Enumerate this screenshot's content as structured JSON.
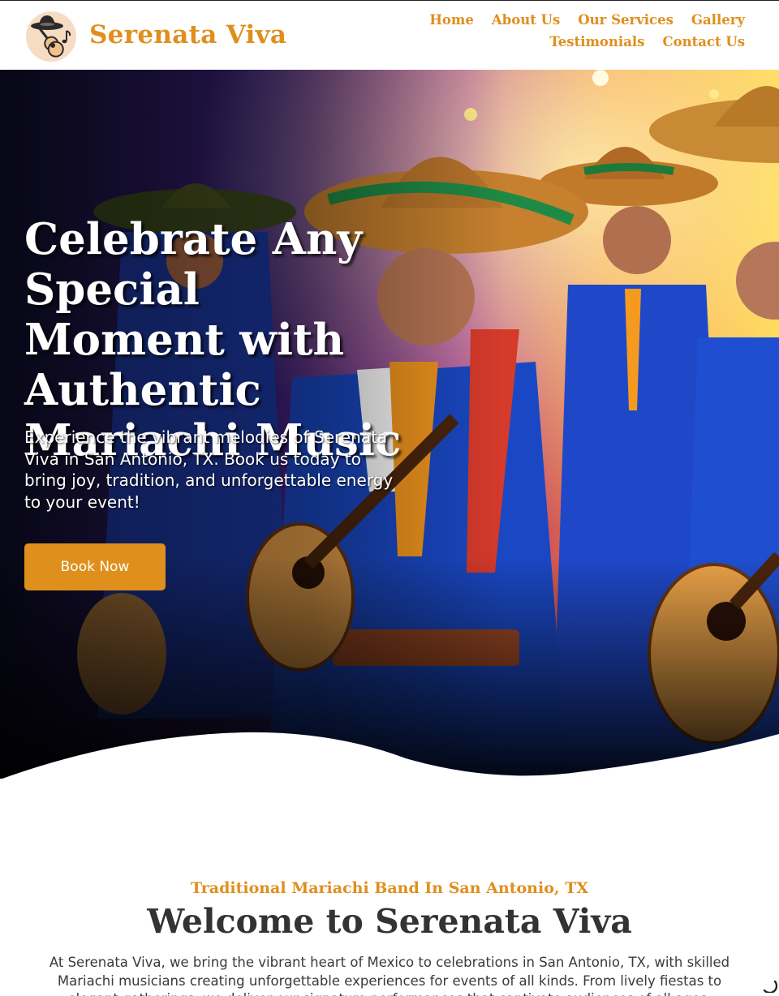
{
  "brand": {
    "name": "Serenata Viva",
    "logo_icon": "mariachi-guitar-logo-icon"
  },
  "nav": {
    "row1": [
      "Home",
      "About Us",
      "Our Services",
      "Gallery"
    ],
    "row2": [
      "Testimonials",
      "Contact Us"
    ]
  },
  "hero": {
    "title": "Celebrate Any Special Moment with Authentic Mariachi Music",
    "subtitle": "Experience the vibrant melodies of Serenata Viva in San Antonio, TX. Book us today to bring joy, tradition, and unforgettable energy to your event!",
    "cta_label": "Book Now",
    "image_subject": "mariachi-band-photo"
  },
  "welcome": {
    "eyebrow": "Traditional Mariachi Band In San Antonio, TX",
    "title": "Welcome to Serenata Viva",
    "body": "At Serenata Viva, we bring the vibrant heart of Mexico to celebrations in San Antonio, TX, with skilled Mariachi musicians creating unforgettable experiences for events of all kinds. From lively fiestas to elegant gatherings, we deliver our signature performances that captivate audiences of all ages."
  },
  "colors": {
    "accent": "#df8f1c",
    "text_dark": "#333333",
    "background": "#ffffff"
  }
}
